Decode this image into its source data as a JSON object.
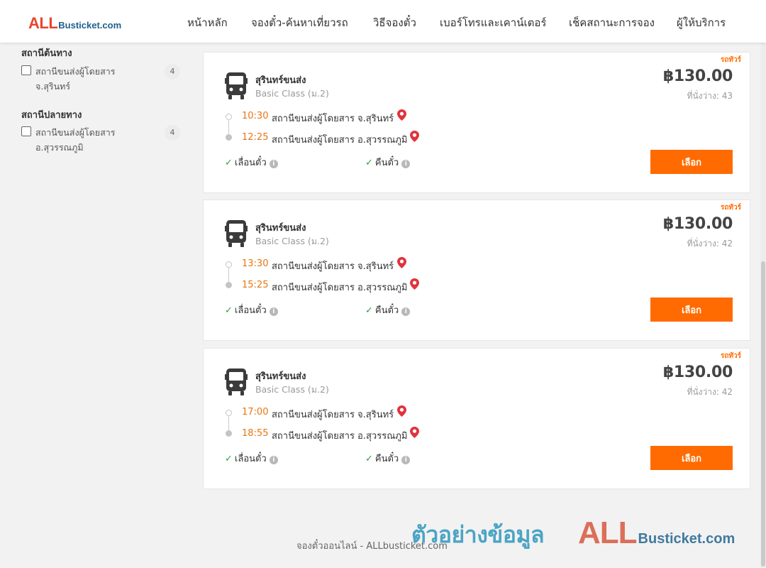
{
  "header": {
    "logo_all": "ALL",
    "logo_rest": "Busticket.com",
    "nav": [
      {
        "label": "หน้าหลัก"
      },
      {
        "label": "จองตั๋ว-ค้นหาเที่ยวรถ"
      },
      {
        "label": "วิธีจองตั๋ว"
      },
      {
        "label": "เบอร์โทรและเคาน์เตอร์"
      },
      {
        "label": "เช็คสถานะการจอง"
      },
      {
        "label": "ผู้ให้บริการ"
      }
    ]
  },
  "sidebar": {
    "origin": {
      "title": "สถานีต้นทาง",
      "options": [
        {
          "line1": "สถานีขนส่งผู้โดยสาร",
          "line2": "จ.สุรินทร์",
          "count": "4"
        }
      ]
    },
    "destination": {
      "title": "สถานีปลายทาง",
      "options": [
        {
          "line1": "สถานีขนส่งผู้โดยสาร",
          "line2": "อ.สุวรรณภูมิ",
          "count": "4"
        }
      ]
    }
  },
  "trips": [
    {
      "tag": "รถทัวร์",
      "operator": "สุรินทร์ขนส่ง",
      "bus_class": "Basic Class (ม.2)",
      "price": "฿130.00",
      "seats": "ที่นั่งว่าง: 43",
      "depart_time": "10:30",
      "depart_station": "สถานีขนส่งผู้โดยสาร จ.สุรินทร์",
      "arrive_time": "12:25",
      "arrive_station": "สถานีขนส่งผู้โดยสาร อ.สุวรรณภูมิ",
      "feature_1": "เลื่อนตั๋ว",
      "feature_2": "คืนตั๋ว",
      "button": "เลือก"
    },
    {
      "tag": "รถทัวร์",
      "operator": "สุรินทร์ขนส่ง",
      "bus_class": "Basic Class (ม.2)",
      "price": "฿130.00",
      "seats": "ที่นั่งว่าง: 42",
      "depart_time": "13:30",
      "depart_station": "สถานีขนส่งผู้โดยสาร จ.สุรินทร์",
      "arrive_time": "15:25",
      "arrive_station": "สถานีขนส่งผู้โดยสาร อ.สุวรรณภูมิ",
      "feature_1": "เลื่อนตั๋ว",
      "feature_2": "คืนตั๋ว",
      "button": "เลือก"
    },
    {
      "tag": "รถทัวร์",
      "operator": "สุรินทร์ขนส่ง",
      "bus_class": "Basic Class (ม.2)",
      "price": "฿130.00",
      "seats": "ที่นั่งว่าง: 42",
      "depart_time": "17:00",
      "depart_station": "สถานีขนส่งผู้โดยสาร จ.สุรินทร์",
      "arrive_time": "18:55",
      "arrive_station": "สถานีขนส่งผู้โดยสาร อ.สุวรรณภูมิ",
      "feature_1": "เลื่อนตั๋ว",
      "feature_2": "คืนตั๋ว",
      "button": "เลือก"
    }
  ],
  "footer": {
    "text": "จองตั๋วออนไลน์ - ALLbusticket.com"
  },
  "watermark": {
    "text": "ตัวอย่างข้อมูล",
    "logo_all": "ALL",
    "logo_rest": "Busticket.com"
  },
  "colors": {
    "accent": "#ff6b00",
    "time": "#e87511",
    "pin": "#e0343e",
    "check": "#2e9e3e",
    "brand_red": "#e8452c",
    "brand_blue": "#1e5f8c"
  },
  "icons": {
    "bus": "bus-icon",
    "pin": "map-pin-icon",
    "check": "check-icon",
    "info": "info-icon"
  }
}
